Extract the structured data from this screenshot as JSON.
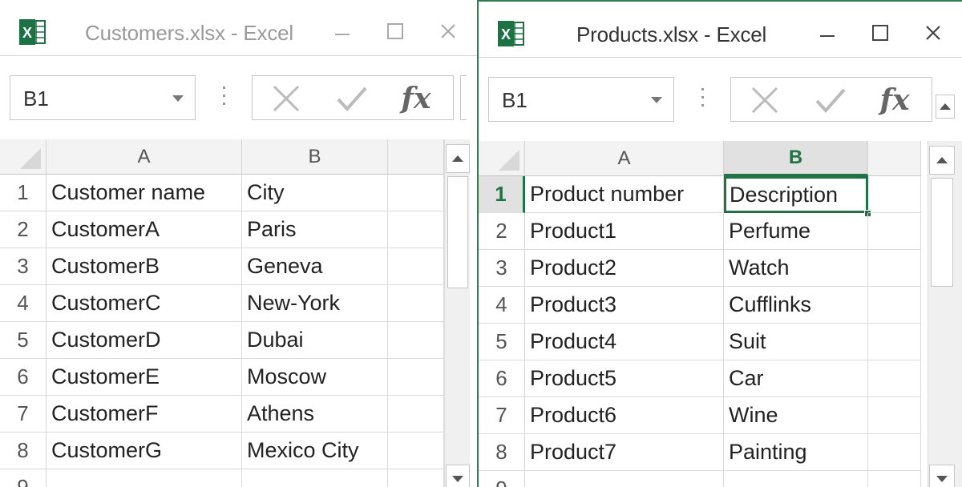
{
  "windows": {
    "left": {
      "title": "Customers.xlsx - Excel",
      "active": false,
      "name_box": "B1",
      "columns": [
        "A",
        "B"
      ],
      "row_numbers": [
        "1",
        "2",
        "3",
        "4",
        "5",
        "6",
        "7",
        "8",
        "9"
      ],
      "rows": [
        [
          "Customer name",
          "City"
        ],
        [
          "CustomerA",
          "Paris"
        ],
        [
          "CustomerB",
          "Geneva"
        ],
        [
          "CustomerC",
          "New-York"
        ],
        [
          "CustomerD",
          "Dubai"
        ],
        [
          "CustomerE",
          "Moscow"
        ],
        [
          "CustomerF",
          "Athens"
        ],
        [
          "CustomerG",
          "Mexico City"
        ]
      ]
    },
    "right": {
      "title": "Products.xlsx - Excel",
      "active": true,
      "name_box": "B1",
      "columns": [
        "A",
        "B"
      ],
      "row_numbers": [
        "1",
        "2",
        "3",
        "4",
        "5",
        "6",
        "7",
        "8",
        "9"
      ],
      "rows": [
        [
          "Product number",
          "Description"
        ],
        [
          "Product1",
          "Perfume"
        ],
        [
          "Product2",
          "Watch"
        ],
        [
          "Product3",
          "Cufflinks"
        ],
        [
          "Product4",
          "Suit"
        ],
        [
          "Product5",
          "Car"
        ],
        [
          "Product6",
          "Wine"
        ],
        [
          "Product7",
          "Painting"
        ]
      ]
    }
  },
  "fx_label": "fx",
  "icons": {
    "app": "excel-icon",
    "minimize": "minimize-icon",
    "maximize": "maximize-icon",
    "close": "close-icon",
    "cancel": "cancel-x-icon",
    "enter": "enter-check-icon",
    "scroll_up": "scroll-up-icon",
    "scroll_down": "scroll-down-icon"
  },
  "colors": {
    "excel_green": "#217346",
    "active_border": "#2e7d4f"
  }
}
